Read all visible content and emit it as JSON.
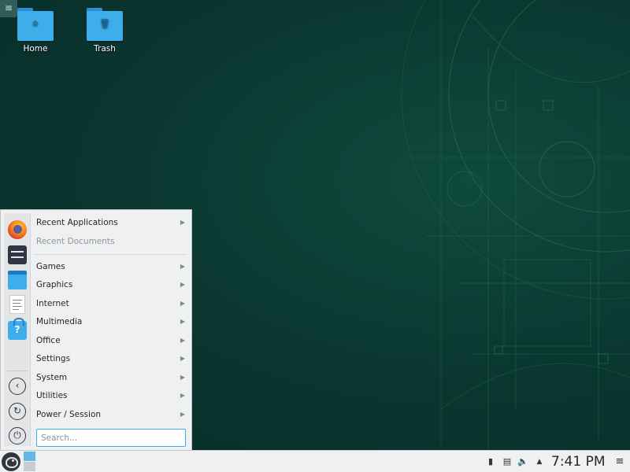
{
  "desktop": {
    "toolbox_icon": "hamburger-icon",
    "icons": [
      {
        "label": "Home",
        "icon": "home-folder-icon",
        "glyph": "⌂"
      },
      {
        "label": "Trash",
        "icon": "trash-folder-icon",
        "glyph": "🗑"
      }
    ]
  },
  "menu": {
    "favorites": [
      "firefox-icon",
      "system-settings-icon",
      "file-manager-icon",
      "text-editor-icon",
      "software-store-icon"
    ],
    "actions": [
      {
        "name": "back-icon",
        "glyph": "‹"
      },
      {
        "name": "refresh-icon",
        "glyph": "↻"
      },
      {
        "name": "power-icon",
        "glyph": "⏻"
      }
    ],
    "categories": [
      {
        "label": "Recent Applications",
        "enabled": true
      },
      {
        "label": "Recent Documents",
        "enabled": false
      },
      {
        "label": "Games",
        "enabled": true
      },
      {
        "label": "Graphics",
        "enabled": true
      },
      {
        "label": "Internet",
        "enabled": true
      },
      {
        "label": "Multimedia",
        "enabled": true
      },
      {
        "label": "Office",
        "enabled": true
      },
      {
        "label": "Settings",
        "enabled": true
      },
      {
        "label": "System",
        "enabled": true
      },
      {
        "label": "Utilities",
        "enabled": true
      },
      {
        "label": "Power / Session",
        "enabled": true
      }
    ],
    "arrow": "▶",
    "search_placeholder": "Search..."
  },
  "panel": {
    "tray": [
      {
        "name": "device-notifier-icon",
        "glyph": "▮"
      },
      {
        "name": "clipboard-icon",
        "glyph": "▤"
      },
      {
        "name": "volume-icon",
        "glyph": "🔈"
      },
      {
        "name": "show-hidden-arrow-icon",
        "glyph": "▲"
      }
    ],
    "clock": "7:41 PM",
    "menu_glyph": "≡"
  },
  "colors": {
    "wallpaper": "#0b3a33",
    "accent": "#3daee9",
    "panel": "#eff0f1"
  }
}
